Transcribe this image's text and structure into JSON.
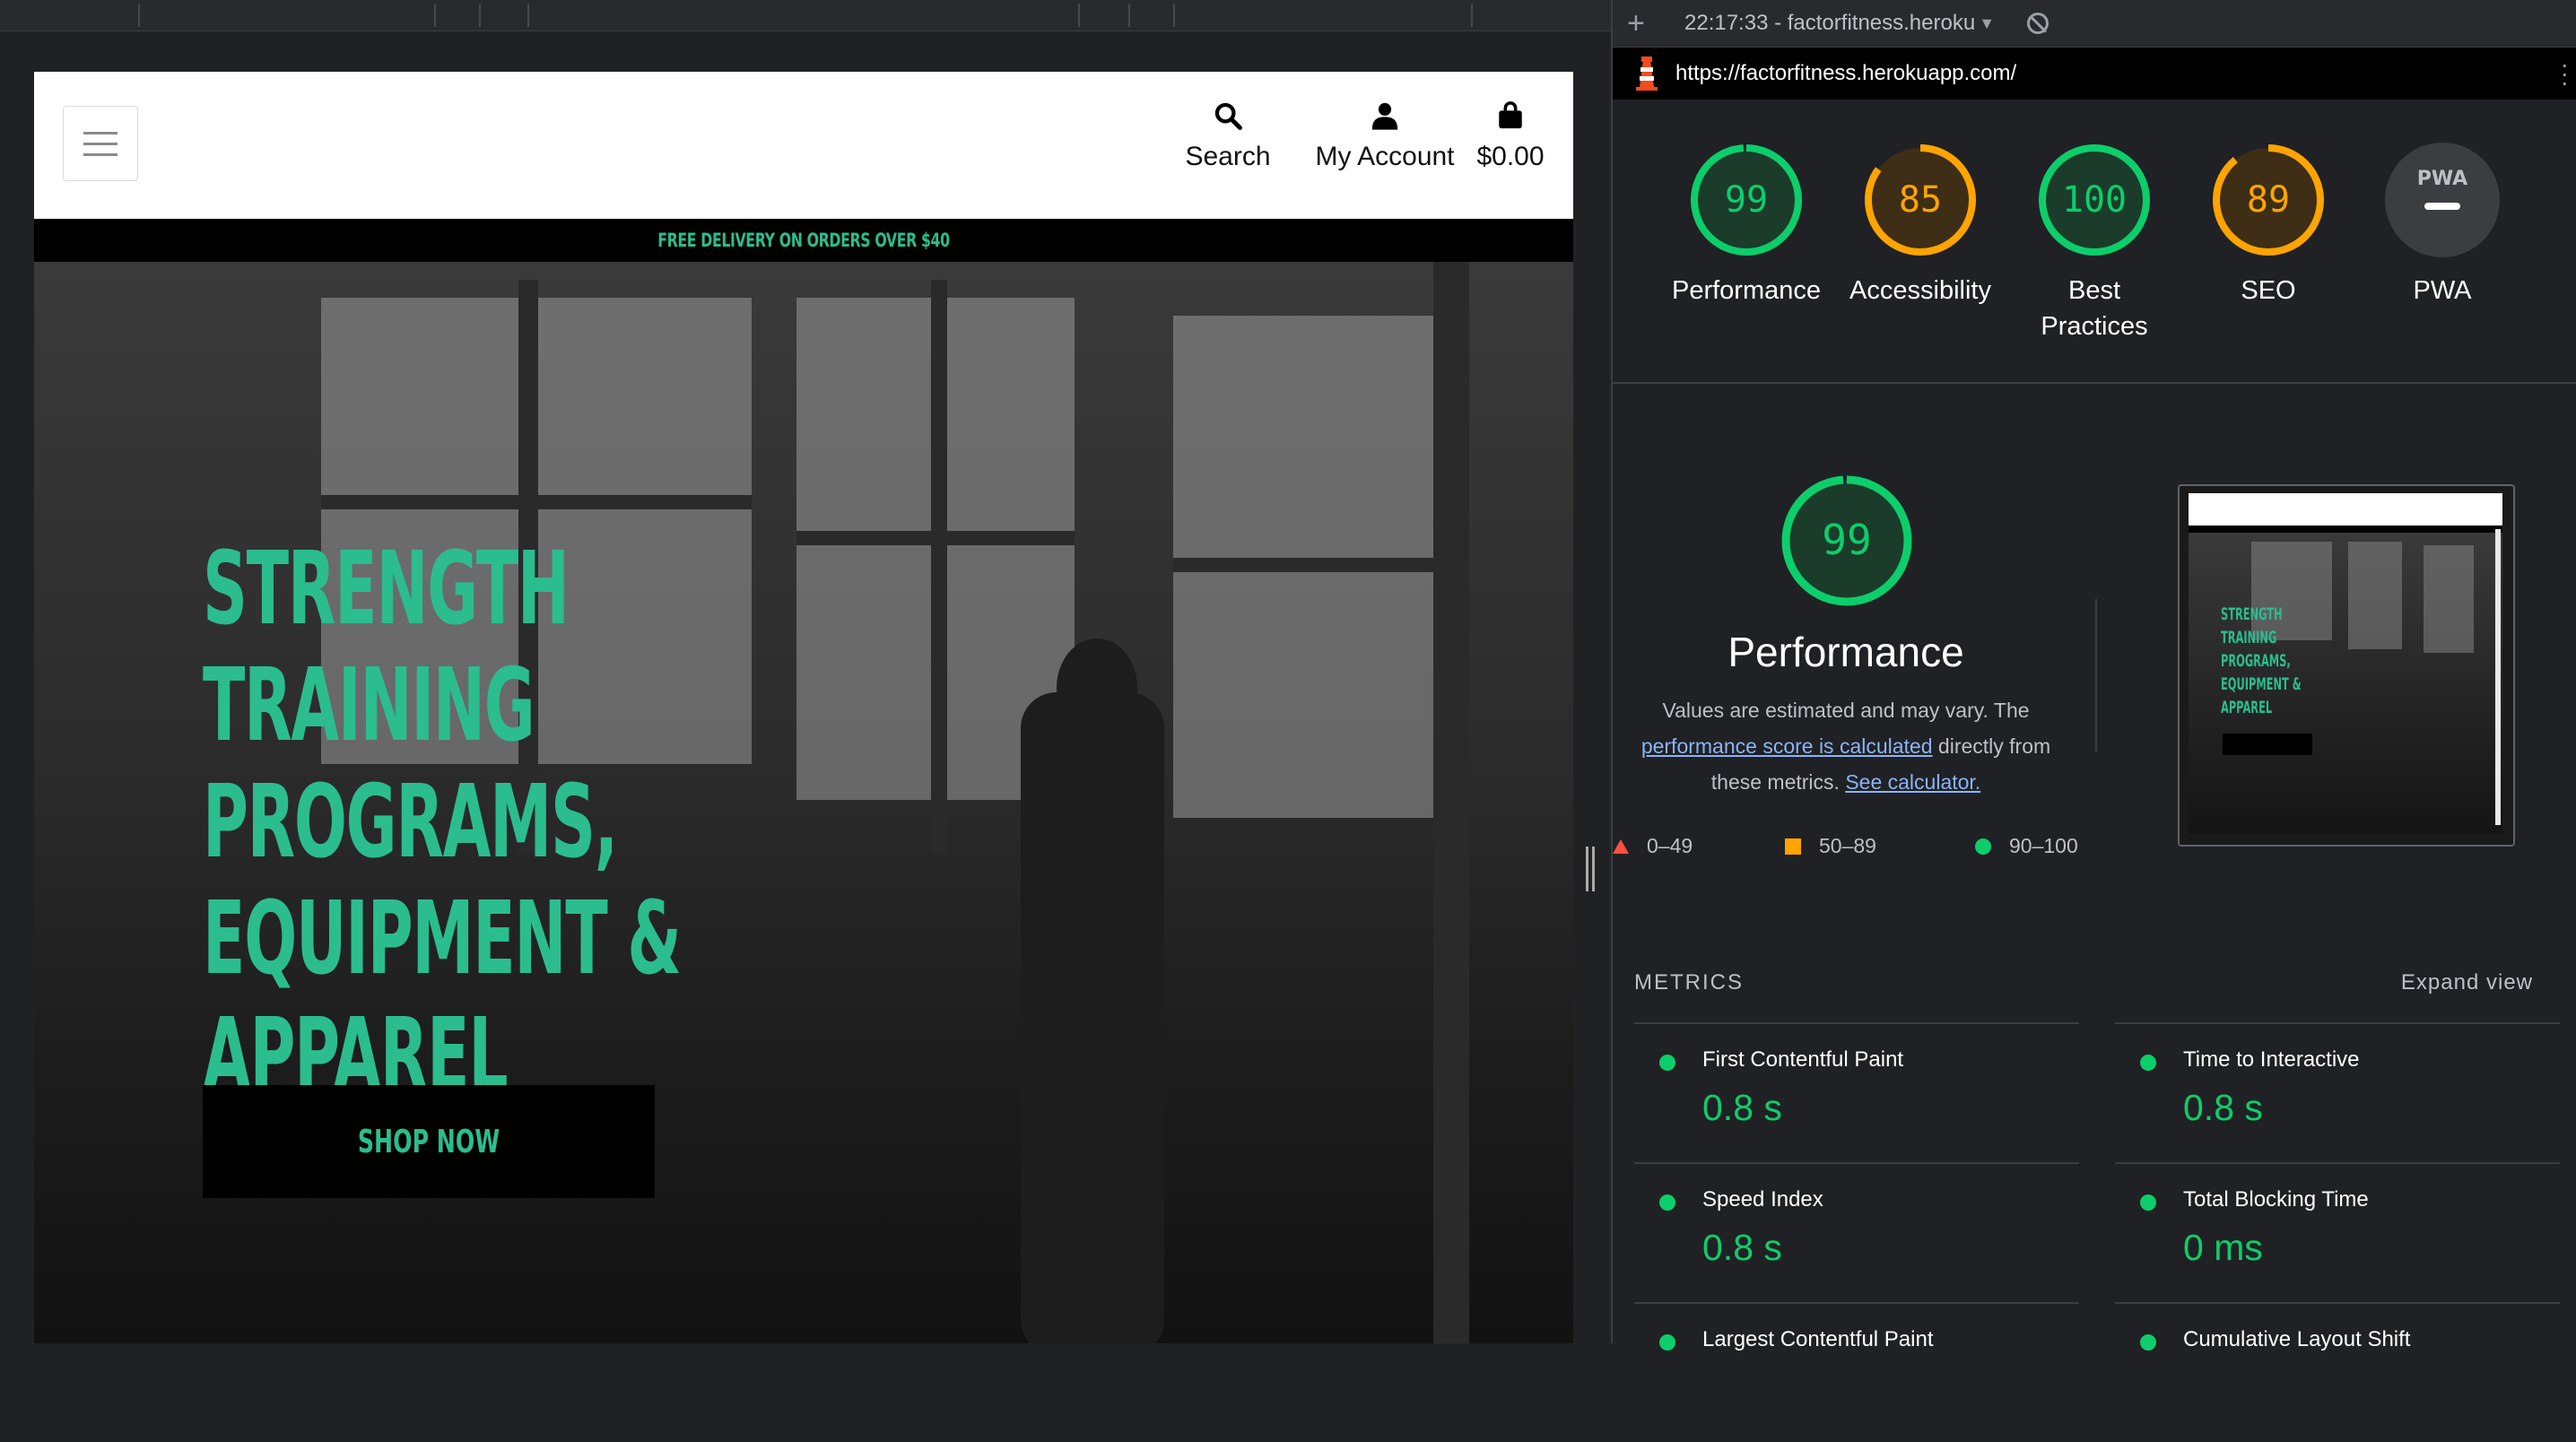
{
  "site": {
    "nav": {
      "search_label": "Search",
      "account_label": "My Account",
      "cart_total": "$0.00"
    },
    "delivery_banner": "FREE DELIVERY ON ORDERS OVER $40",
    "hero": {
      "title_lines": [
        "STRENGTH",
        "TRAINING",
        "PROGRAMS,",
        "EQUIPMENT &",
        "APPAREL"
      ],
      "cta": "SHOP NOW"
    },
    "accent_color": "#2bbd8e"
  },
  "devtools": {
    "report_selector": "22:17:33 - factorfitness.heroku",
    "url": "https://factorfitness.herokuapp.com/",
    "scores": [
      {
        "label": "Performance",
        "value": "99",
        "color": "#0cce6b",
        "fraction": 0.99
      },
      {
        "label": "Accessibility",
        "value": "85",
        "color": "#ffa400",
        "fraction": 0.85
      },
      {
        "label": "Best Practices",
        "value": "100",
        "color": "#0cce6b",
        "fraction": 1.0
      },
      {
        "label": "SEO",
        "value": "89",
        "color": "#ffa400",
        "fraction": 0.89
      },
      {
        "label": "PWA",
        "value": "PWA",
        "color": "#9aa0a6"
      }
    ],
    "performance": {
      "score": "99",
      "title": "Performance",
      "desc_part1": "Values are estimated and may vary. The",
      "desc_link1": "performance score is calculated",
      "desc_part2": "directly from these metrics.",
      "desc_link2": "See calculator.",
      "legend": {
        "fail": "0–49",
        "average": "50–89",
        "pass": "90–100"
      }
    },
    "metrics_heading": "METRICS",
    "expand_label": "Expand view",
    "metrics": [
      {
        "name": "First Contentful Paint",
        "value": "0.8 s"
      },
      {
        "name": "Time to Interactive",
        "value": "0.8 s"
      },
      {
        "name": "Speed Index",
        "value": "0.8 s"
      },
      {
        "name": "Total Blocking Time",
        "value": "0 ms"
      },
      {
        "name": "Largest Contentful Paint",
        "value": ""
      },
      {
        "name": "Cumulative Layout Shift",
        "value": ""
      }
    ],
    "colors": {
      "pass": "#0cce6b",
      "average": "#ffa400",
      "fail": "#ff4e42"
    }
  }
}
